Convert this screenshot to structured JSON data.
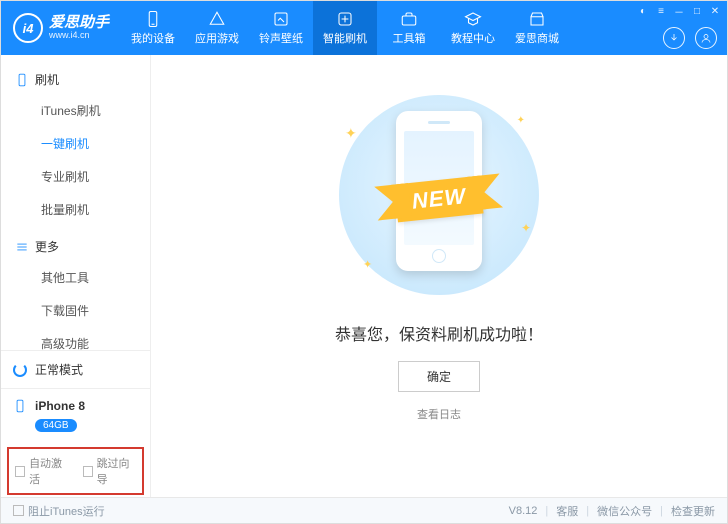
{
  "app": {
    "name": "爱思助手",
    "url": "www.i4.cn",
    "logo_letters": "i4"
  },
  "nav": [
    {
      "label": "我的设备",
      "icon": "device"
    },
    {
      "label": "应用游戏",
      "icon": "apps"
    },
    {
      "label": "铃声壁纸",
      "icon": "media"
    },
    {
      "label": "智能刷机",
      "icon": "flash",
      "active": true
    },
    {
      "label": "工具箱",
      "icon": "toolbox"
    },
    {
      "label": "教程中心",
      "icon": "school"
    },
    {
      "label": "爱思商城",
      "icon": "store"
    }
  ],
  "sidebar": {
    "sections": [
      {
        "title": "刷机",
        "icon": "phone",
        "items": [
          "iTunes刷机",
          "一键刷机",
          "专业刷机",
          "批量刷机"
        ],
        "activeIndex": 1
      },
      {
        "title": "更多",
        "icon": "more",
        "items": [
          "其他工具",
          "下载固件",
          "高级功能"
        ],
        "activeIndex": -1
      }
    ],
    "mode": "正常模式",
    "device": {
      "name": "iPhone 8",
      "storage": "64GB"
    },
    "options": {
      "autoActivate": "自动激活",
      "skipGuide": "跳过向导"
    }
  },
  "main": {
    "ribbon": "NEW",
    "successText": "恭喜您，保资料刷机成功啦！",
    "okButton": "确定",
    "viewLog": "查看日志"
  },
  "footer": {
    "blockITunes": "阻止iTunes运行",
    "version": "V8.12",
    "links": [
      "客服",
      "微信公众号",
      "检查更新"
    ]
  }
}
